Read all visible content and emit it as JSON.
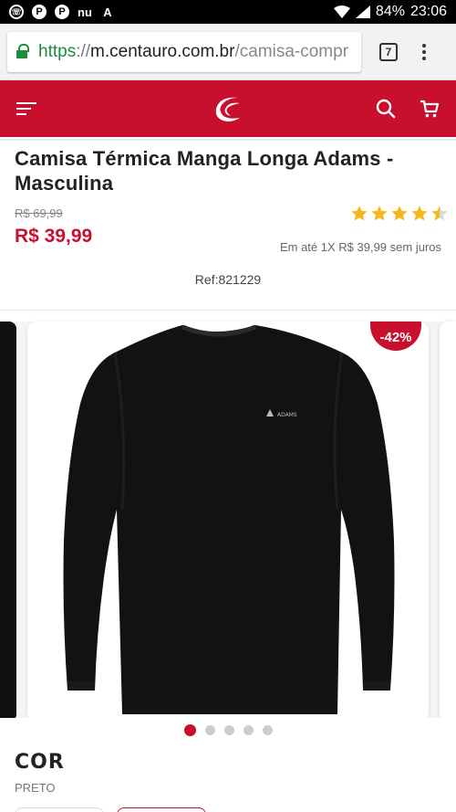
{
  "status_bar": {
    "battery": "84%",
    "time": "23:06",
    "left_icons": [
      "whatsapp-icon",
      "pinterest-icon",
      "pinterest-icon",
      "nuvem-icon",
      "adobe-icon"
    ]
  },
  "browser": {
    "url_scheme": "https",
    "url_sep": "://",
    "url_host": "m.centauro.com.br",
    "url_path": "/camisa-compr",
    "tab_count": "7"
  },
  "colors": {
    "brand_red": "#c8102e",
    "star_gold": "#f5b81c"
  },
  "product": {
    "title": "Camisa Térmica Manga Longa Adams - Masculina",
    "old_price": "R$ 69,99",
    "price": "R$ 39,99",
    "rating": 4.5,
    "installments": "Em até 1X R$ 39,99 sem juros",
    "ref": "Ref:821229",
    "discount": "-42%",
    "brand_on_shirt": "ADAMS"
  },
  "gallery": {
    "total_images": 5,
    "active_index": 0
  },
  "color_section": {
    "title": "COR",
    "value": "PRETO"
  }
}
